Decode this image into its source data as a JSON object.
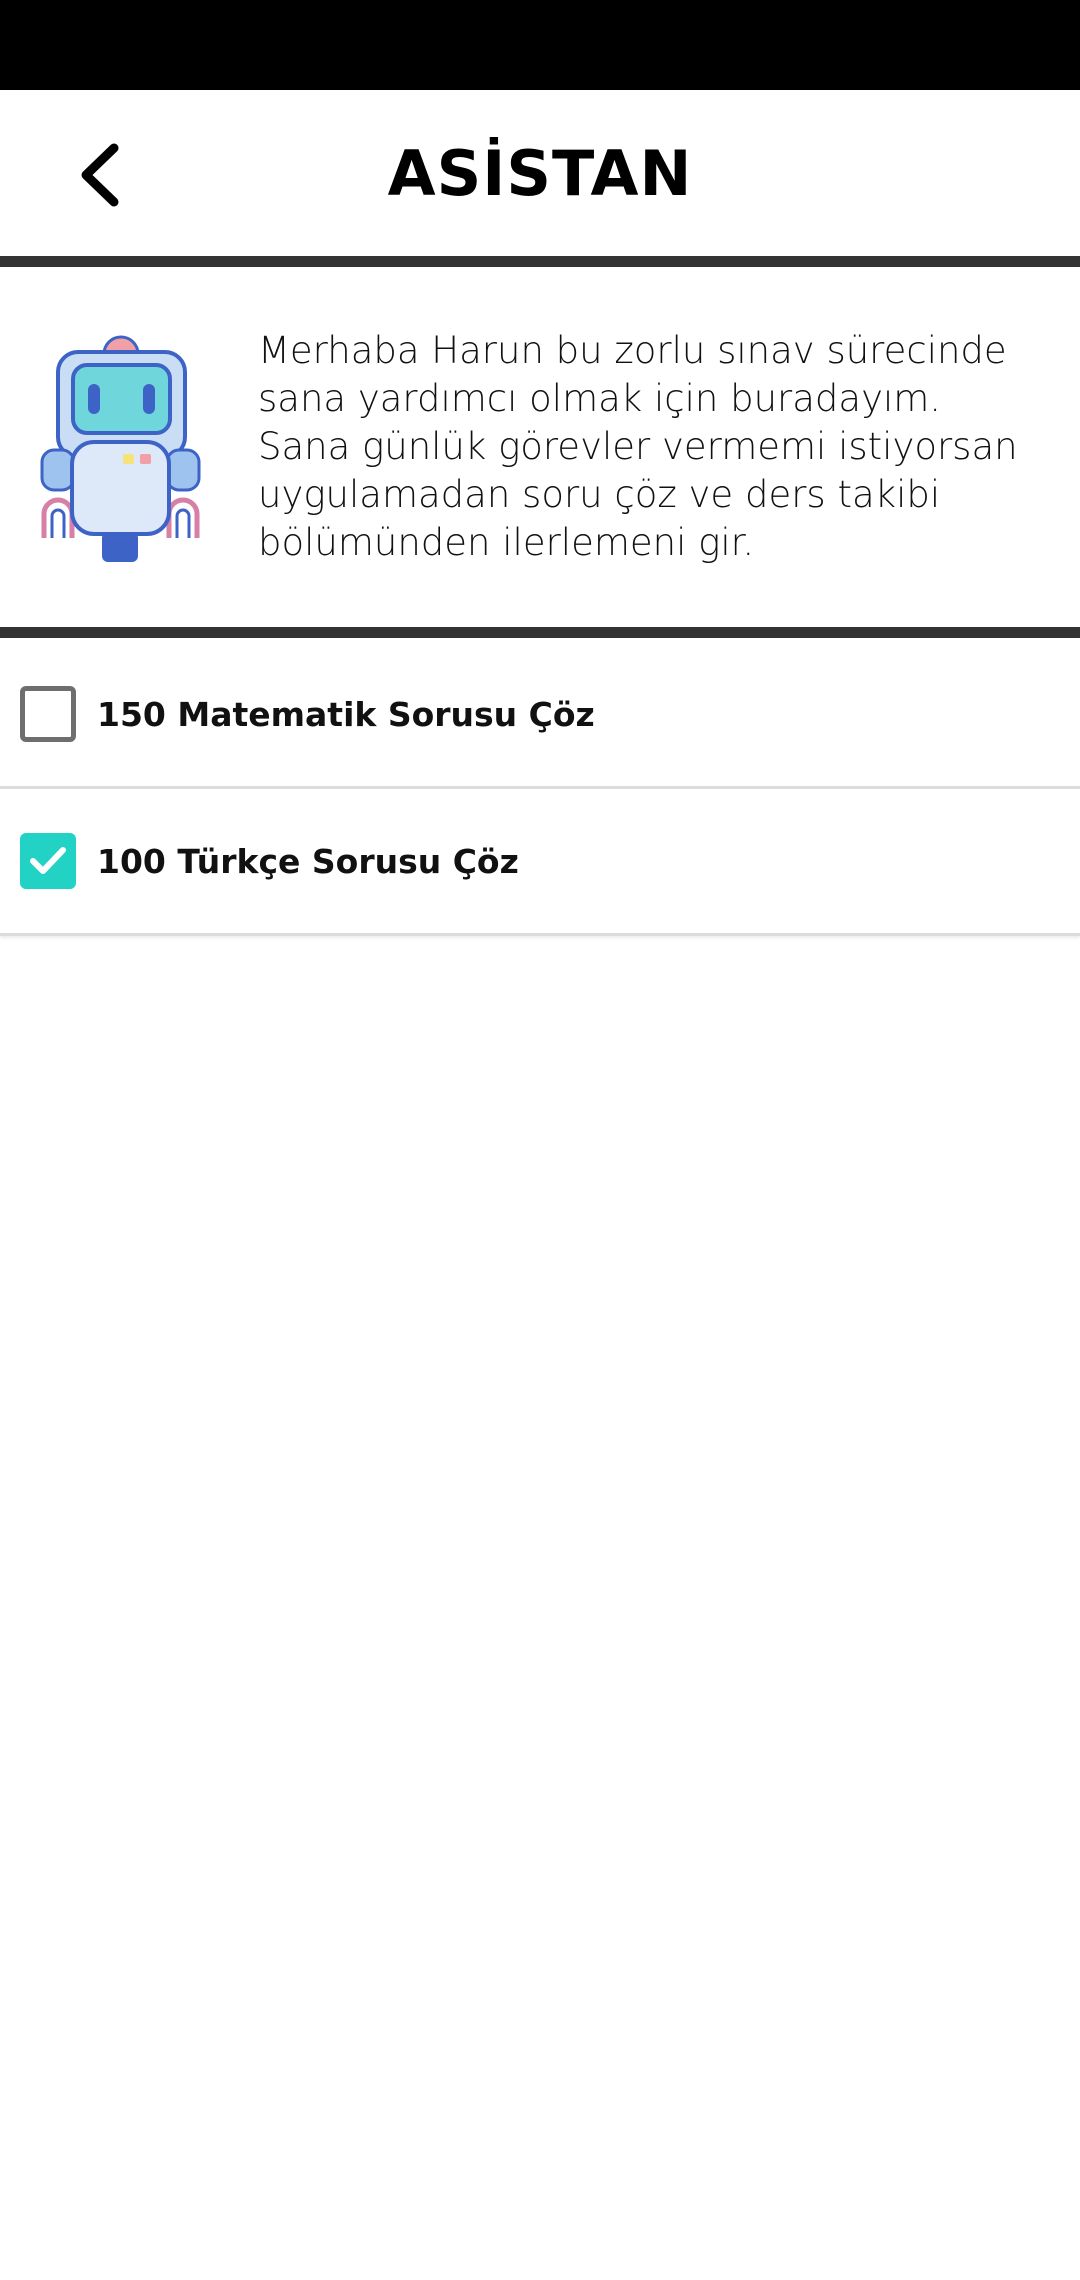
{
  "header": {
    "title": "ASİSTAN",
    "back_icon": "chevron-left-icon"
  },
  "assistant": {
    "avatar_icon": "robot-icon",
    "message_lines": [
      "Merhaba Harun bu zorlu sınav sürecinde",
      "sana yardımcı olmak için buradayım.",
      "Sana günlük görevler vermemi istiyorsan",
      "uygulamadan soru çöz ve ders takibi",
      "bölümünden ilerlemeni gir."
    ]
  },
  "tasks": [
    {
      "label": "150 Matematik Sorusu Çöz",
      "checked": false
    },
    {
      "label": "100 Türkçe Sorusu Çöz",
      "checked": true
    }
  ],
  "colors": {
    "accent": "#22d3c5",
    "divider": "#333333",
    "status_bar": "#000000"
  }
}
